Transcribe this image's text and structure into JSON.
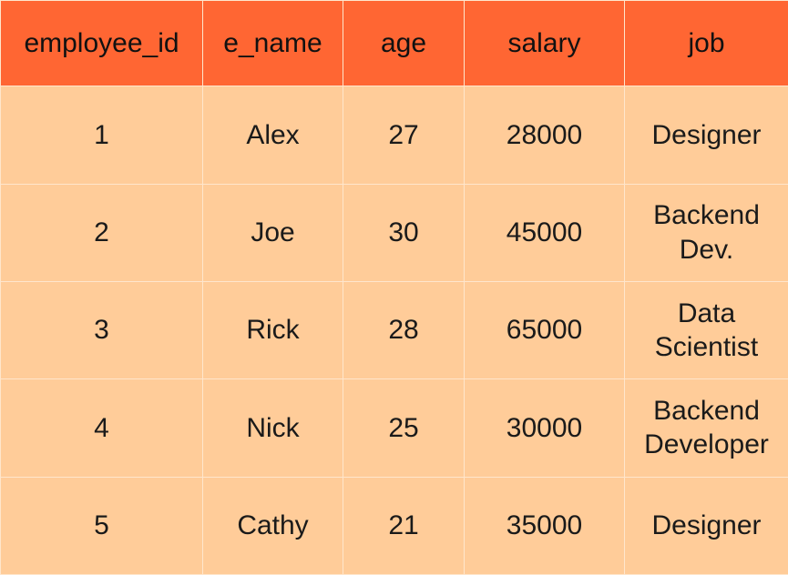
{
  "table": {
    "headers": [
      "employee_id",
      "e_name",
      "age",
      "salary",
      "job"
    ],
    "rows": [
      {
        "employee_id": "1",
        "e_name": "Alex",
        "age": "27",
        "salary": "28000",
        "job": "Designer"
      },
      {
        "employee_id": "2",
        "e_name": "Joe",
        "age": "30",
        "salary": "45000",
        "job": "Backend Dev."
      },
      {
        "employee_id": "3",
        "e_name": "Rick",
        "age": "28",
        "salary": "65000",
        "job": "Data Scientist"
      },
      {
        "employee_id": "4",
        "e_name": "Nick",
        "age": "25",
        "salary": "30000",
        "job": "Backend Developer"
      },
      {
        "employee_id": "5",
        "e_name": "Cathy",
        "age": "21",
        "salary": "35000",
        "job": "Designer"
      }
    ]
  },
  "chart_data": {
    "type": "table",
    "columns": [
      "employee_id",
      "e_name",
      "age",
      "salary",
      "job"
    ],
    "rows": [
      [
        1,
        "Alex",
        27,
        28000,
        "Designer"
      ],
      [
        2,
        "Joe",
        30,
        45000,
        "Backend Dev."
      ],
      [
        3,
        "Rick",
        28,
        65000,
        "Data Scientist"
      ],
      [
        4,
        "Nick",
        25,
        30000,
        "Backend Developer"
      ],
      [
        5,
        "Cathy",
        21,
        35000,
        "Designer"
      ]
    ]
  }
}
